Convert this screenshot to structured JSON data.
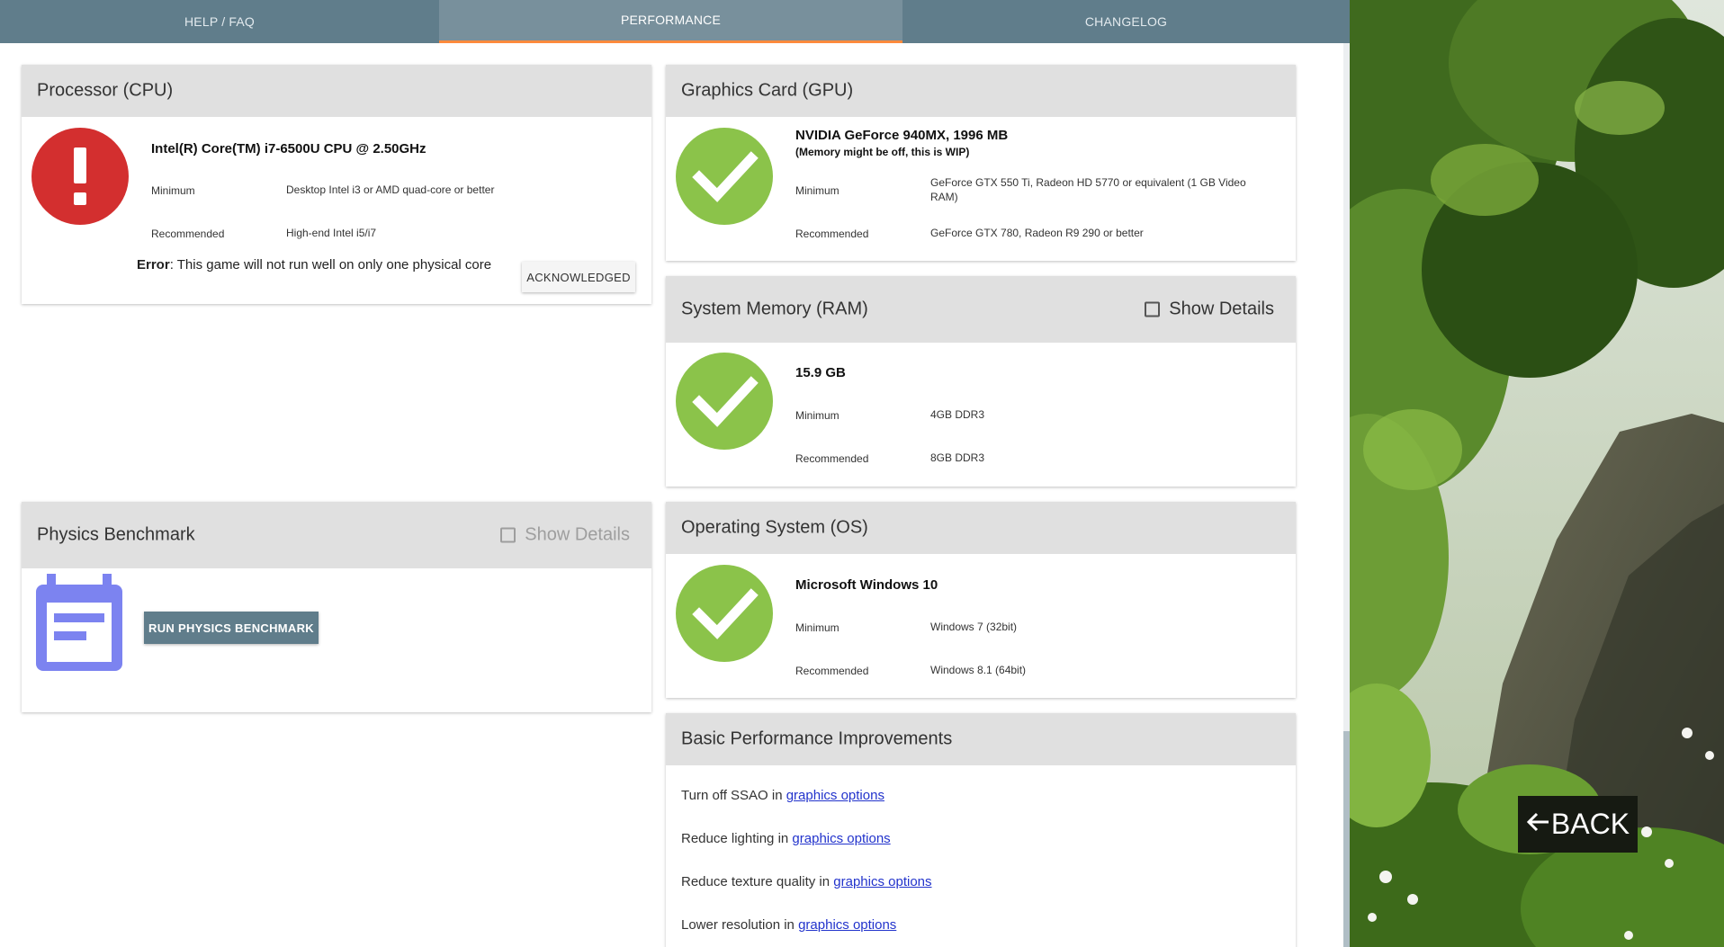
{
  "tabs": [
    {
      "label": "HELP / FAQ",
      "active": false
    },
    {
      "label": "PERFORMANCE",
      "active": true
    },
    {
      "label": "CHANGELOG",
      "active": false
    }
  ],
  "cpu": {
    "title": "Processor (CPU)",
    "status": "error",
    "status_icon": "exclamation-icon",
    "name": "Intel(R) Core(TM) i7-6500U CPU @ 2.50GHz",
    "minimum_label": "Minimum",
    "minimum_value": "Desktop Intel i3 or AMD quad-core or better",
    "recommended_label": "Recommended",
    "recommended_value": "High-end Intel i5/i7",
    "error_prefix": "Error",
    "error_text": ": This game will not run well on only one physical core",
    "acknowledge_label": "ACKNOWLEDGED"
  },
  "gpu": {
    "title": "Graphics Card (GPU)",
    "status": "ok",
    "status_icon": "checkmark-icon",
    "name": "NVIDIA GeForce 940MX, 1996 MB",
    "note": "(Memory might be off, this is WIP)",
    "minimum_label": "Minimum",
    "minimum_value": "GeForce GTX 550 Ti, Radeon HD 5770 or equivalent (1 GB Video RAM)",
    "recommended_label": "Recommended",
    "recommended_value": "GeForce GTX 780, Radeon R9 290 or better"
  },
  "ram": {
    "title": "System Memory (RAM)",
    "show_details_label": "Show Details",
    "status": "ok",
    "status_icon": "checkmark-icon",
    "name": "15.9 GB",
    "minimum_label": "Minimum",
    "minimum_value": "4GB DDR3",
    "recommended_label": "Recommended",
    "recommended_value": "8GB DDR3"
  },
  "physics": {
    "title": "Physics Benchmark",
    "show_details_label": "Show Details",
    "show_details_disabled": true,
    "icon": "calendar-icon",
    "run_button_label": "RUN PHYSICS BENCHMARK"
  },
  "os": {
    "title": "Operating System (OS)",
    "status": "ok",
    "status_icon": "checkmark-icon",
    "name": "Microsoft Windows 10",
    "minimum_label": "Minimum",
    "minimum_value": "Windows 7 (32bit)",
    "recommended_label": "Recommended",
    "recommended_value": "Windows 8.1 (64bit)"
  },
  "improvements": {
    "title": "Basic Performance Improvements",
    "items": [
      {
        "text": "Turn off SSAO in ",
        "link": "graphics options"
      },
      {
        "text": "Reduce lighting in ",
        "link": "graphics options"
      },
      {
        "text": "Reduce texture quality in ",
        "link": "graphics options"
      },
      {
        "text": "Lower resolution in ",
        "link": "graphics options"
      }
    ]
  },
  "back_button": {
    "icon": "arrow-left-icon",
    "label": "BACK"
  },
  "colors": {
    "tab_bar": "#607d8b",
    "tab_active": "#78909c",
    "tab_indicator": "#ff8a3d",
    "ok": "#8bc34a",
    "error": "#d32f2f",
    "calendar": "#7c83f0",
    "link": "#2233cc"
  }
}
